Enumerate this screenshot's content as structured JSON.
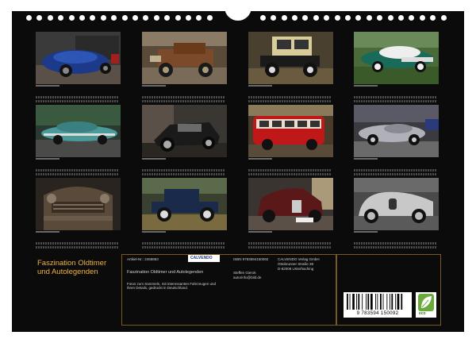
{
  "cover": {
    "title_line1": "Faszination Oldtimer",
    "title_line2": "und Autolegenden"
  },
  "info": {
    "article": "Artikel-Nr.: 2458883",
    "publisher_logo": "CALVENDO",
    "isbn": "ISBN 9783594150092",
    "publisher_name": "CALVENDO Verlag GmbH",
    "street": "Ottobrunner Straße 38",
    "city": "D-82008 Unterhaching",
    "calendar_title": "Faszination Oldtimer und Autolegenden",
    "author": "Steffen Gierok",
    "author_contact": "autorinfo@bild.de",
    "description": "Fotos zum Sammeln, mit interessanten Fahrzeugen und ihren Details, gedruckt in Deutschland."
  },
  "barcode": {
    "number": "9 783594 150092"
  },
  "eco_label": "eco",
  "icons": {
    "barcode": "barcode-icon",
    "eco": "eco-leaf-icon",
    "hanger": "hanger-hole-icon"
  },
  "photos": [
    {
      "name": "blue-roadster"
    },
    {
      "name": "brown-vintage-car"
    },
    {
      "name": "black-cream-classic-car"
    },
    {
      "name": "green-white-fifties-car"
    },
    {
      "name": "teal-cadillac"
    },
    {
      "name": "black-convertible"
    },
    {
      "name": "red-bus"
    },
    {
      "name": "silver-jaguar"
    },
    {
      "name": "rusty-truck-front"
    },
    {
      "name": "blue-ford-model-a"
    },
    {
      "name": "red-vintage-sedan"
    },
    {
      "name": "silver-bmw-328"
    }
  ]
}
